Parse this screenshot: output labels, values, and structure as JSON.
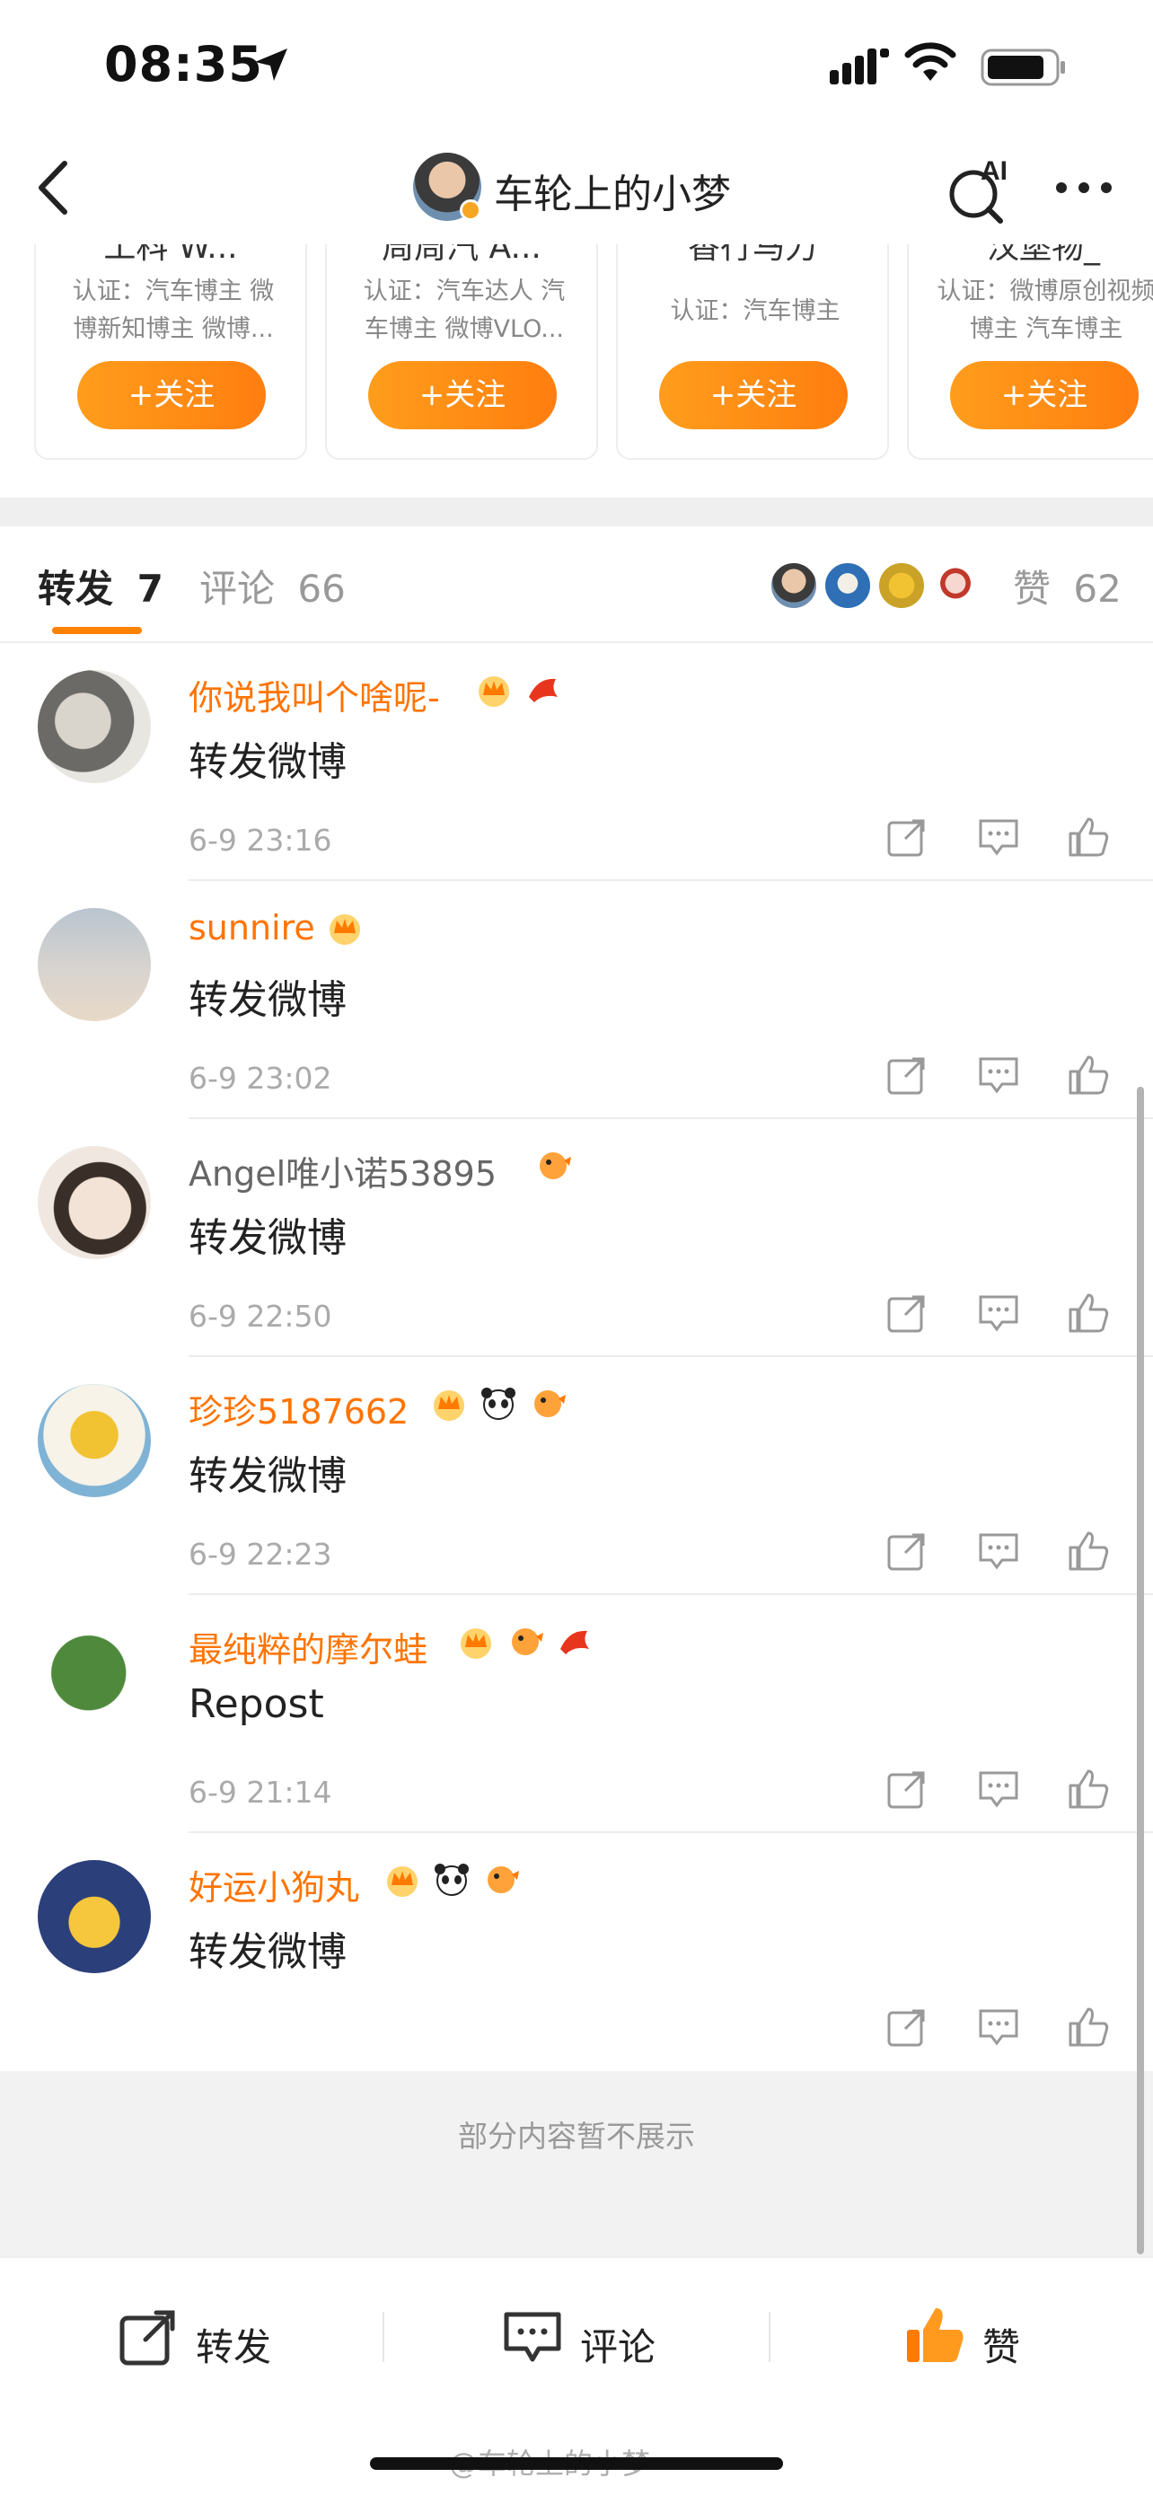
{
  "status_bar": {
    "time": "08:35"
  },
  "nav": {
    "title": "车轮上的小梦",
    "ai_label": "AI"
  },
  "cards": [
    {
      "name": "工科 W...",
      "desc": "认证：汽车博主 微博新知博主 微博...",
      "button": "+关注"
    },
    {
      "name": "周周汽 A...",
      "desc": "认证：汽车达人 汽车博主 微博VLO...",
      "button": "+关注"
    },
    {
      "name": "香行马力",
      "desc": "认证：汽车博主",
      "button": "+关注"
    },
    {
      "name": "汉堡物_",
      "desc": "认证：微博原创视频博主 汽车博主",
      "button": "+关注"
    }
  ],
  "tabs": {
    "repost_label": "转发",
    "repost_count": "7",
    "comment_label": "评论",
    "comment_count": "66",
    "like_label": "赞",
    "like_count": "62"
  },
  "items": [
    {
      "name": "你说我叫个啥呢-",
      "content": "转发微博",
      "time": "6-9 23:16"
    },
    {
      "name": "sunnire",
      "content": "转发微博",
      "time": "6-9 23:02"
    },
    {
      "name": "Angel唯小诺53895",
      "content": "转发微博",
      "time": "6-9 22:50"
    },
    {
      "name": "珍珍5187662",
      "content": "转发微博",
      "time": "6-9 22:23"
    },
    {
      "name": "最纯粹的摩尔蛙",
      "content": "Repost",
      "time": "6-9 21:14"
    },
    {
      "name": "好运小狗丸",
      "content": "转发微博",
      "time": ""
    }
  ],
  "notice": "部分内容暂不展示",
  "toolbar": {
    "repost": "转发",
    "comment": "评论",
    "like": "赞"
  },
  "watermark": "@车轮上的小梦",
  "colors": {
    "accent": "#ff8200",
    "name_orange": "#ff7400"
  }
}
